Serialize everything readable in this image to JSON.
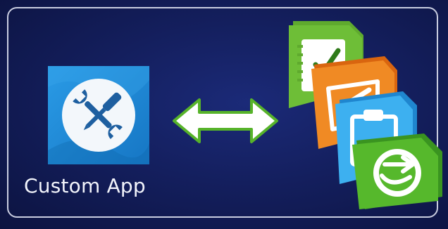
{
  "custom_app": {
    "label": "Custom App",
    "icon": "wrench-screwdriver-icon",
    "tile_color": "#1d8ad9"
  },
  "connector": {
    "icon": "double-arrow-icon",
    "fill": "#ffffff",
    "stroke": "#57b32a"
  },
  "app_stack": [
    {
      "name": "survey-app-icon",
      "icon": "checklist-icon",
      "color": "#5faa2e"
    },
    {
      "name": "workforce-app-icon",
      "icon": "edit-form-icon",
      "color": "#e57a1c"
    },
    {
      "name": "clipboard-app-icon",
      "icon": "clipboard-icon",
      "color": "#2e9fe0"
    },
    {
      "name": "navigator-app-icon",
      "icon": "route-arrow-icon",
      "color": "#4aa52a"
    }
  ]
}
